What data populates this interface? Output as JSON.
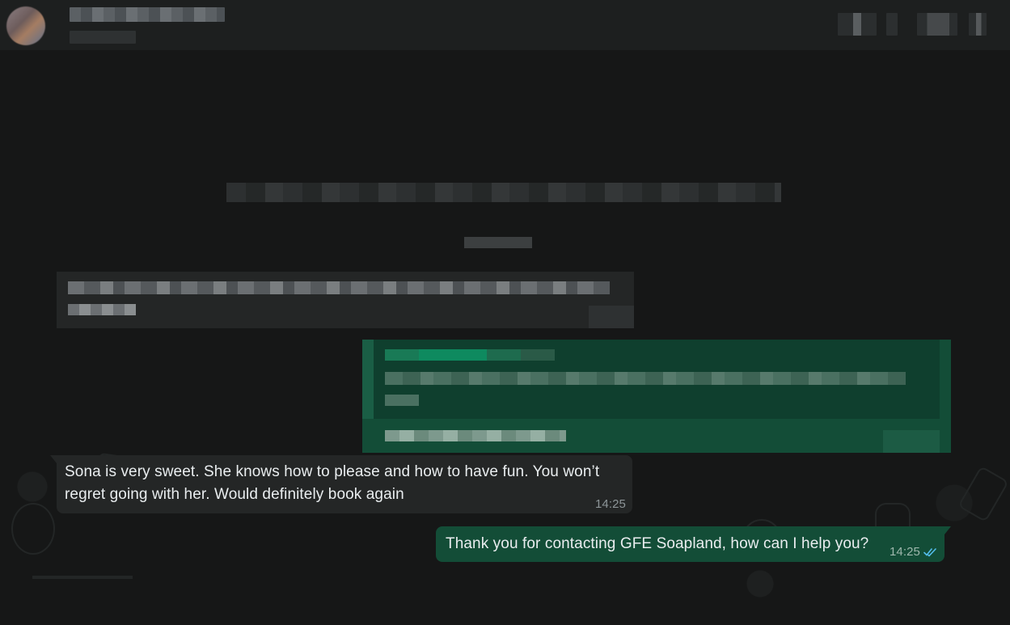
{
  "chat": {
    "messages": [
      {
        "direction": "incoming",
        "text": "Sona is very sweet. She knows how to please and how to have fun. You won’t regret going with her. Would definitely book again",
        "time": "14:25"
      },
      {
        "direction": "outgoing",
        "text": "Thank you for contacting GFE Soapland, how can I help you?",
        "time": "14:25",
        "status_icon": "double-check-read-icon"
      }
    ]
  },
  "colors": {
    "background": "#161717",
    "incoming_bubble": "#242626",
    "outgoing_bubble": "#134d37",
    "text": "#e9edef",
    "read_ticks": "#53bdeb"
  }
}
